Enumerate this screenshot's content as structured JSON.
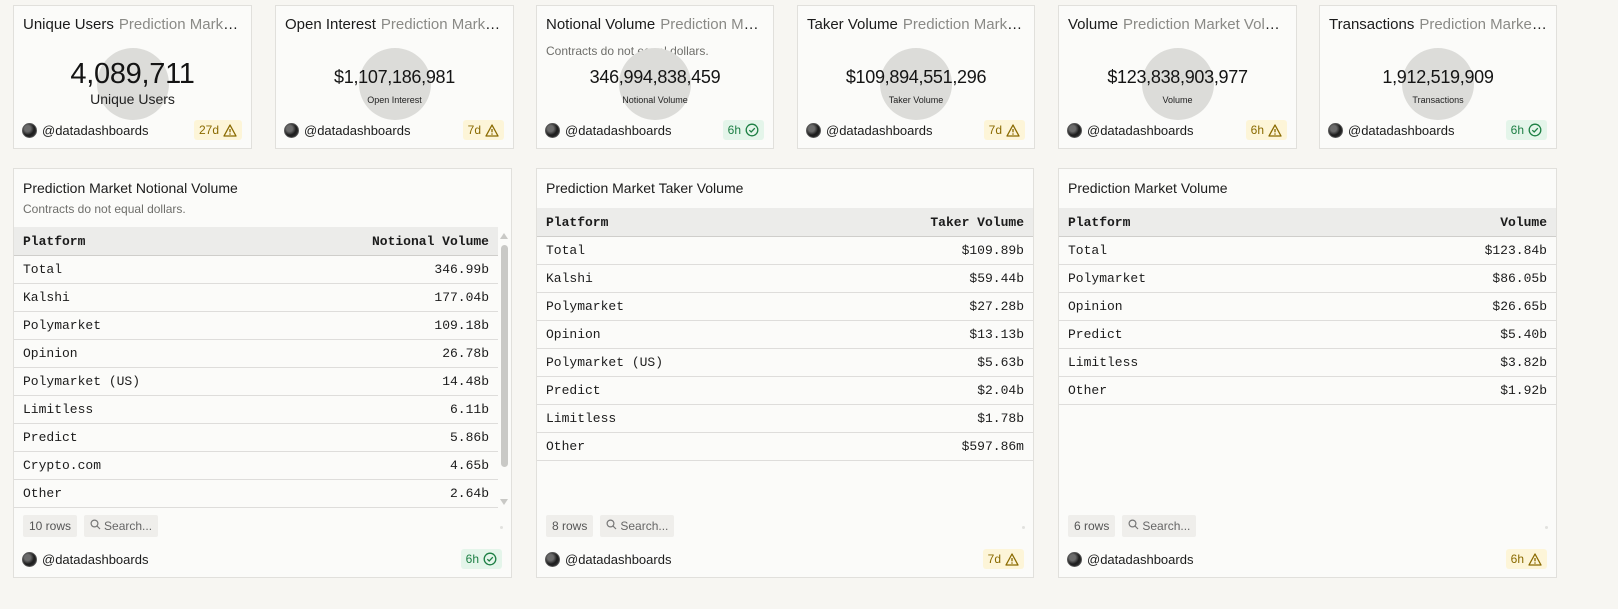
{
  "counters": [
    {
      "title": "Unique Users",
      "subtitle": "Prediction Market U...",
      "note": "",
      "value": "4,089,711",
      "label": "Unique Users",
      "author": "@datadashboards",
      "age": "27d",
      "status": "warn"
    },
    {
      "title": "Open Interest",
      "subtitle": "Prediction Market ...",
      "note": "",
      "value": "$1,107,186,981",
      "label": "Open Interest",
      "author": "@datadashboards",
      "age": "7d",
      "status": "warn"
    },
    {
      "title": "Notional Volume",
      "subtitle": "Prediction Mark...",
      "note": "Contracts do not equal dollars.",
      "value": "346,994,838,459",
      "label": "Notional Volume",
      "author": "@datadashboards",
      "age": "6h",
      "status": "ok"
    },
    {
      "title": "Taker Volume",
      "subtitle": "Prediction Market T...",
      "note": "",
      "value": "$109,894,551,296",
      "label": "Taker Volume",
      "author": "@datadashboards",
      "age": "7d",
      "status": "warn"
    },
    {
      "title": "Volume",
      "subtitle": "Prediction Market Volume",
      "note": "",
      "value": "$123,838,903,977",
      "label": "Volume",
      "author": "@datadashboards",
      "age": "6h",
      "status": "warn"
    },
    {
      "title": "Transactions",
      "subtitle": "Prediction Market Tr...",
      "note": "",
      "value": "1,912,519,909",
      "label": "Transactions",
      "author": "@datadashboards",
      "age": "6h",
      "status": "ok"
    }
  ],
  "tables": [
    {
      "title": "Prediction Market Notional Volume",
      "description": "Contracts do not equal dollars.",
      "columns": [
        "Platform",
        "Notional Volume"
      ],
      "rows": [
        [
          "Total",
          "346.99b"
        ],
        [
          "Kalshi",
          "177.04b"
        ],
        [
          "Polymarket",
          "109.18b"
        ],
        [
          "Opinion",
          "26.78b"
        ],
        [
          "Polymarket (US)",
          "14.48b"
        ],
        [
          "Limitless",
          "6.11b"
        ],
        [
          "Predict",
          "5.86b"
        ],
        [
          "Crypto.com",
          "4.65b"
        ],
        [
          "Other",
          "2.64b"
        ]
      ],
      "rows_label": "10 rows",
      "search_placeholder": "Search...",
      "author": "@datadashboards",
      "age": "6h",
      "status": "ok"
    },
    {
      "title": "Prediction Market Taker Volume",
      "description": "",
      "columns": [
        "Platform",
        "Taker Volume"
      ],
      "rows": [
        [
          "Total",
          "$109.89b"
        ],
        [
          "Kalshi",
          "$59.44b"
        ],
        [
          "Polymarket",
          "$27.28b"
        ],
        [
          "Opinion",
          "$13.13b"
        ],
        [
          "Polymarket (US)",
          "$5.63b"
        ],
        [
          "Predict",
          "$2.04b"
        ],
        [
          "Limitless",
          "$1.78b"
        ],
        [
          "Other",
          "$597.86m"
        ]
      ],
      "rows_label": "8 rows",
      "search_placeholder": "Search...",
      "author": "@datadashboards",
      "age": "7d",
      "status": "warn"
    },
    {
      "title": "Prediction Market Volume",
      "description": "",
      "columns": [
        "Platform",
        "Volume"
      ],
      "rows": [
        [
          "Total",
          "$123.84b"
        ],
        [
          "Polymarket",
          "$86.05b"
        ],
        [
          "Opinion",
          "$26.65b"
        ],
        [
          "Predict",
          "$5.40b"
        ],
        [
          "Limitless",
          "$3.82b"
        ],
        [
          "Other",
          "$1.92b"
        ]
      ],
      "rows_label": "6 rows",
      "search_placeholder": "Search...",
      "author": "@datadashboards",
      "age": "6h",
      "status": "warn"
    }
  ],
  "icons": {
    "warn": "warning-triangle-icon",
    "ok": "check-circle-icon",
    "search": "search-icon",
    "avatar": "avatar"
  },
  "colors": {
    "warn_bg": "#fdf5d8",
    "warn_fg": "#8a6a00",
    "ok_bg": "#e4f5ea",
    "ok_fg": "#1d7f44"
  }
}
